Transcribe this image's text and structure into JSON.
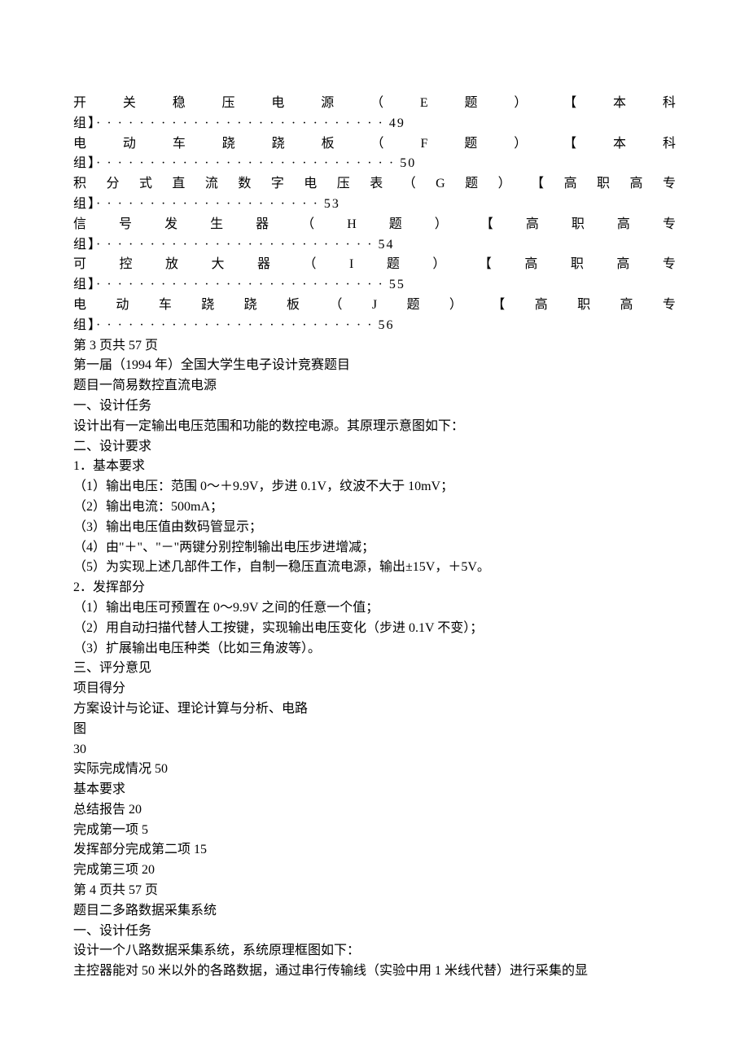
{
  "toc": [
    {
      "line1_chars": "开关稳压电源（E题）【本科",
      "line2": "组】· · · · · · · · · · · · · · · · · · · · · · · · · · · 49"
    },
    {
      "line1_chars": "电动车跷跷板（F题）【本科",
      "line2": "组】· · · · · · · · · · · · · · · · · · · · · · · · · · · ·  50"
    },
    {
      "line1_chars": "积分式直流数字电压表（G题）【高职高专",
      "line2": "组】· · · · · · · · · · · · · · · · · · · · · 53"
    },
    {
      "line1_chars": "信号发生器（H题）【高职高专",
      "line2": "组】· · · · · · · · · · · · · · · · · · · · · · · · · ·  54"
    },
    {
      "line1_chars": "可控放大器（I题）【高职高专",
      "line2": "组】· · · · · · · · · · · · · · · · · · · · · · · · · · ·  55"
    },
    {
      "line1_chars": "电动车跷跷板（J题）【高职高专",
      "line2": "组】· · · · · · · · · · · · · · · · · · · · · · · · · · 56"
    }
  ],
  "lines": [
    "第 3 页共 57 页",
    "第一届（1994 年）全国大学生电子设计竞赛题目",
    "题目一简易数控直流电源",
    "一、设计任务",
    "设计出有一定输出电压范围和功能的数控电源。其原理示意图如下：",
    "二、设计要求",
    "1．基本要求",
    "（1）输出电压：范围 0～＋9.9V，步进 0.1V，纹波不大于 10mV；",
    "（2）输出电流：500mA；",
    "（3）输出电压值由数码管显示；",
    "（4）由\"＋\"、\"－\"两键分别控制输出电压步进增减；",
    "（5）为实现上述几部件工作，自制一稳压直流电源，输出±15V，＋5V。",
    "2．发挥部分",
    "（1）输出电压可预置在 0～9.9V 之间的任意一个值；",
    "（2）用自动扫描代替人工按键，实现输出电压变化（步进 0.1V 不变）；",
    "（3）扩展输出电压种类（比如三角波等）。",
    "三、评分意见",
    "项目得分",
    "方案设计与论证、理论计算与分析、电路",
    "图",
    "30",
    "实际完成情况 50",
    "基本要求",
    "总结报告 20",
    "完成第一项 5",
    "发挥部分完成第二项 15",
    "完成第三项 20",
    "第 4 页共 57 页",
    "题目二多路数据采集系统",
    "一、设计任务",
    "设计一个八路数据采集系统，系统原理框图如下：",
    "主控器能对 50 米以外的各路数据，通过串行传输线（实验中用 1 米线代替）进行采集的显"
  ]
}
